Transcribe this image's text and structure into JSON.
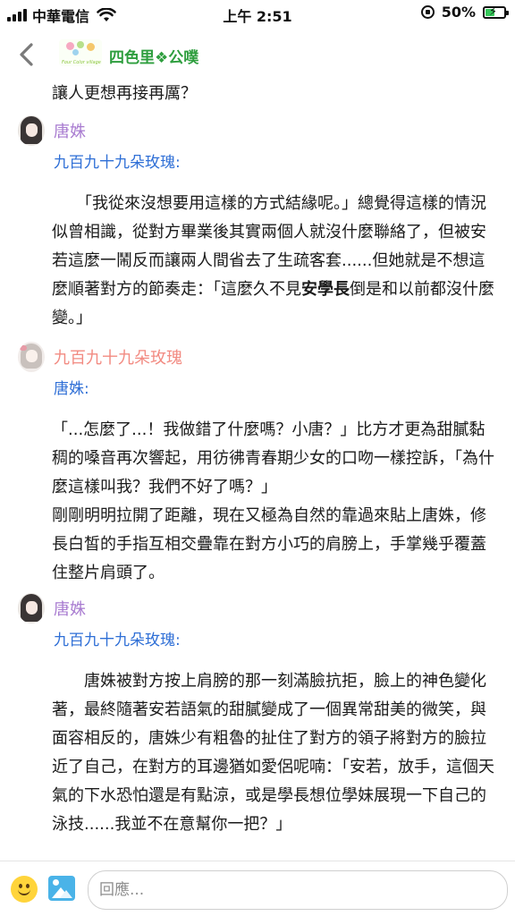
{
  "status_bar": {
    "carrier": "中華電信",
    "time": "上午 2:51",
    "battery_percent": "50%",
    "battery_level": 0.5,
    "battery_color": "#35c759"
  },
  "header": {
    "board_name": "四色里❖公噗",
    "logo_text": "Four Color village",
    "back_icon": "chevron-left-icon"
  },
  "top_line": "讓人更想再接再厲？",
  "posts": [
    {
      "author": "唐姝",
      "author_color": "#a87bd0",
      "quote": "九百九十九朵玫瑰:",
      "body_before": "　　「我從來沒想要用這樣的方式結緣呢。」總覺得這樣的情況似曾相識，從對方畢業後其實兩個人就沒什麼聯絡了，但被安若這麼一鬧反而讓兩人間省去了生疏客套......但她就是不想這麼順著對方的節奏走：「這麼久不見",
      "body_bold": "安學長",
      "body_after": "倒是和以前都沒什麼變。」"
    },
    {
      "author": "九百九十九朵玫瑰",
      "author_color": "#f28b82",
      "quote": "唐姝:",
      "body": "「...怎麼了...！我做錯了什麼嗎？小唐？」比方才更為甜膩黏稠的嗓音再次響起，用彷彿青春期少女的口吻一樣控訴，「為什麼這樣叫我？我們不好了嗎？」\n剛剛明明拉開了距離，現在又極為自然的靠過來貼上唐姝，修長白皙的手指互相交疊靠在對方小巧的肩膀上，手掌幾乎覆蓋住整片肩頭了。"
    },
    {
      "author": "唐姝",
      "author_color": "#a87bd0",
      "quote": "九百九十九朵玫瑰:",
      "body": "　　唐姝被對方按上肩膀的那一刻滿臉抗拒，臉上的神色變化著，最終隨著安若語氣的甜膩變成了一個異常甜美的微笑，與面容相反的，唐姝少有粗魯的扯住了對方的領子將對方的臉拉近了自己，在對方的耳邊猶如愛侶呢喃：「安若，放手，這個天氣的下水恐怕還是有點涼，或是學長想位學妹展現一下自己的泳技......我並不在意幫你一把？」"
    }
  ],
  "reply_bar": {
    "placeholder": "回應...",
    "emoji_icon": "smiley-icon",
    "image_icon": "image-icon"
  }
}
